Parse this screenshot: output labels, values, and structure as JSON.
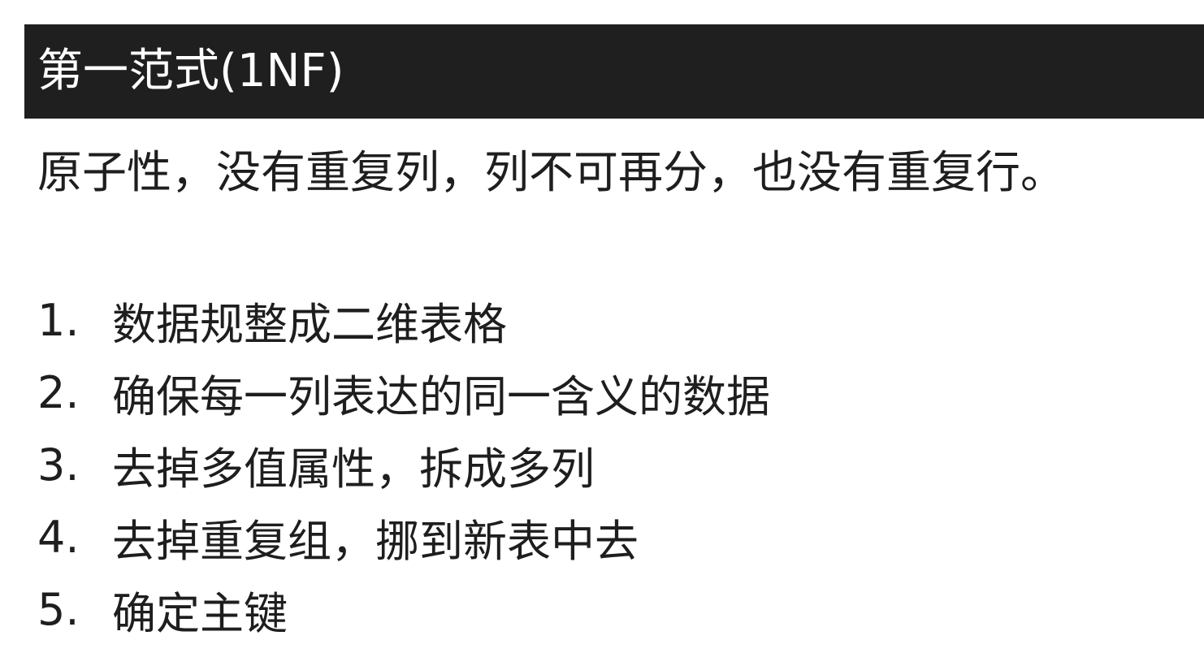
{
  "slide": {
    "title": "第一范式(1NF)",
    "subtitle": "原子性，没有重复列，列不可再分，也没有重复行。",
    "steps": [
      {
        "num": "1.",
        "text": "数据规整成二维表格"
      },
      {
        "num": "2.",
        "text": "确保每一列表达的同一含义的数据"
      },
      {
        "num": "3.",
        "text": "去掉多值属性，拆成多列"
      },
      {
        "num": "4.",
        "text": "去掉重复组，挪到新表中去"
      },
      {
        "num": "5.",
        "text": "确定主键"
      }
    ]
  },
  "colors": {
    "title_background": "#1f1f1f",
    "title_text": "#ffffff",
    "body_text": "#1e1e1e",
    "page_background": "#ffffff"
  }
}
